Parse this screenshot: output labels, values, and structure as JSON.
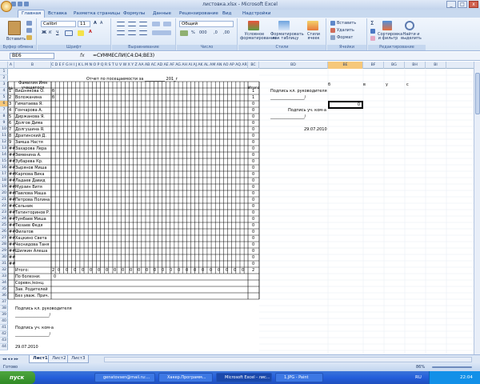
{
  "window": {
    "title": "листовка.xlsx - Microsoft Excel",
    "controls": [
      "_",
      "□",
      "x"
    ]
  },
  "ribbon_tabs": [
    "Главная",
    "Вставка",
    "Разметка страницы",
    "Формулы",
    "Данные",
    "Рецензирование",
    "Вид",
    "Надстройки"
  ],
  "ribbon": {
    "paste": "Вставить",
    "clipboard_group": "Буфер обмена",
    "font_name": "Calibri",
    "font_size": "11",
    "font_group": "Шрифт",
    "align_group": "Выравнивание",
    "number_format": "Общий",
    "number_group": "Число",
    "cond_format": "Условное форматирование",
    "format_table": "Форматировать как таблицу",
    "cell_styles": "Стили ячеек",
    "styles_group": "Стили",
    "insert": "Вставить",
    "delete": "Удалить",
    "format": "Формат",
    "cells_group": "Ячейки",
    "sort_filter": "Сортировка и фильтр",
    "find_select": "Найти и выделить",
    "edit_group": "Редактирование"
  },
  "formula_bar": {
    "name_box": "BE6",
    "fx": "fx",
    "formula": "=СУММЕСЛИ(C4:D4;BE3)"
  },
  "columns": {
    "a": "A",
    "b": "B",
    "narrow": "C D E F G H I J K L M N O P Q R S T U V W X Y Z AA AB AC AD AE AF AG AH AI AJ AK AL AM AN AO AP AQ AR AS AT AU AV AW AX AY AZ BA BB BC",
    "bc": "BC",
    "bd": "BD",
    "be": "BE",
    "bf": "BF",
    "bg": "BG",
    "bh": "BH",
    "bi": "BI"
  },
  "rows": [
    "1",
    "2",
    "3",
    "4",
    "5",
    "6",
    "7",
    "8",
    "9",
    "10",
    "11",
    "12",
    "13",
    "14",
    "15",
    "16",
    "17",
    "18",
    "19",
    "20",
    "21",
    "22",
    "23",
    "24",
    "25",
    "26",
    "27",
    "28",
    "29",
    "30",
    "31",
    "32",
    "33",
    "34",
    "35",
    "36",
    "37",
    "38",
    "39",
    "40",
    "41",
    "42",
    "43",
    "44"
  ],
  "sheet": {
    "report_title": "Отчет по посещаемости за __________ 201_г",
    "hdr_num": "№",
    "hdr_name": "Фамилия Имя учащегося",
    "hdr_total": "Итого",
    "students": [
      {
        "n": "1",
        "name": "Вишнякова О.",
        "mark": "б",
        "total": "1"
      },
      {
        "n": "2",
        "name": "Воложанина",
        "mark": "б",
        "total": "1"
      },
      {
        "n": "3",
        "name": "Гиматаева Я.",
        "mark": "",
        "total": "0"
      },
      {
        "n": "4",
        "name": "Гончарова А.",
        "mark": "",
        "total": "0"
      },
      {
        "n": "5",
        "name": "Диржанова Я.",
        "mark": "",
        "total": "0"
      },
      {
        "n": "6",
        "name": "Долгов Дима",
        "mark": "",
        "total": "0"
      },
      {
        "n": "7",
        "name": "Долгушина Я.",
        "mark": "",
        "total": "0"
      },
      {
        "n": "8",
        "name": "Дратинский Д.",
        "mark": "",
        "total": "0"
      },
      {
        "n": "9",
        "name": "Замша Настя",
        "mark": "",
        "total": "0"
      },
      {
        "n": "##",
        "name": "Захарова Лера",
        "mark": "",
        "total": "0"
      },
      {
        "n": "##",
        "name": "Земенина А.",
        "mark": "",
        "total": "0"
      },
      {
        "n": "##",
        "name": "Зубарева Кр.",
        "mark": "",
        "total": "0"
      },
      {
        "n": "##",
        "name": "Зырянов Миша",
        "mark": "",
        "total": "0"
      },
      {
        "n": "##",
        "name": "Карпова Вика",
        "mark": "",
        "total": "0"
      },
      {
        "n": "##",
        "name": "Ладаев Давид",
        "mark": "",
        "total": "0"
      },
      {
        "n": "##",
        "name": "Мурзин Витя",
        "mark": "",
        "total": "0"
      },
      {
        "n": "##",
        "name": "Павлова Маша",
        "mark": "",
        "total": "0"
      },
      {
        "n": "##",
        "name": "Петрова Полина",
        "mark": "",
        "total": "0"
      },
      {
        "n": "##",
        "name": "Сельник",
        "mark": "",
        "total": "0"
      },
      {
        "n": "##",
        "name": "Татинторинов Р.",
        "mark": "",
        "total": "0"
      },
      {
        "n": "##",
        "name": "Тумбаев Миша",
        "mark": "",
        "total": "0"
      },
      {
        "n": "##",
        "name": "Тюзаев Федя",
        "mark": "",
        "total": "0"
      },
      {
        "n": "##",
        "name": "Филатов",
        "mark": "",
        "total": "0"
      },
      {
        "n": "##",
        "name": "Хацкино Света",
        "mark": "",
        "total": "0"
      },
      {
        "n": "##",
        "name": "Чеснидова Таня",
        "mark": "",
        "total": "0"
      },
      {
        "n": "##",
        "name": "Шилкин Алеша",
        "mark": "",
        "total": "0"
      },
      {
        "n": "##",
        "name": "",
        "mark": "",
        "total": "0"
      },
      {
        "n": "##",
        "name": "",
        "mark": "",
        "total": "0"
      }
    ],
    "row32_label": "Итого:",
    "row32_first": "2",
    "row32_zero": "0",
    "row32_total": "2",
    "row33": "По болезни:",
    "row33_val": "0",
    "row34": "Соревн./конц.",
    "row35": "Зав. Родителей",
    "row36": "Без уваж. Прич.",
    "row38": "Подпись кл. руководителя",
    "row39": "_________________/",
    "row41": "Подпись уч. ком-а",
    "row42": "_________________/",
    "row44": "29.07.2010",
    "right_b": "б",
    "right_v": "в",
    "right_u": "у",
    "right_s": "с",
    "right_sign1": "Подпись кл. руководителя",
    "right_sign1_line": "_________________/",
    "right_be6": "0",
    "right_sign2": "Подпись уч. ком-а",
    "right_sign2_line": "_________________/",
    "right_date": "29.07.2010"
  },
  "sheet_tabs": [
    "Лист1",
    "Лист2",
    "Лист3"
  ],
  "status": {
    "left": "Готово",
    "zoom": "86%"
  },
  "taskbar": {
    "start": "пуск",
    "items": [
      "genatovsen@mail.ru:...",
      "Хакер.Программ...",
      "Microsoft Excel - лис...",
      "1.JPG - Paint"
    ],
    "lang": "RU",
    "clock": "22:04"
  }
}
